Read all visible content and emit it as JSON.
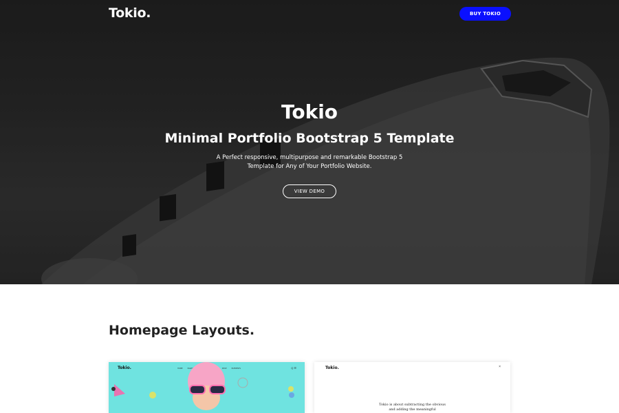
{
  "header": {
    "brand": "Tokio.",
    "buy_button": "BUY TOKIO"
  },
  "hero": {
    "title": "Tokio",
    "subtitle": "Minimal Portfolio Bootstrap 5 Template",
    "description": "A Perfect responsive, multipurpose and remarkable Bootstrap 5 Template for Any of Your Portfolio Website.",
    "demo_button": "VIEW DEMO"
  },
  "section": {
    "title": "Homepage Layouts."
  },
  "cards": [
    {
      "brand": "Tokio.",
      "nav": [
        "HOME",
        "PAGES",
        "PORTFOLIO",
        "BLOG",
        "SHOP",
        "ELEMENTS"
      ],
      "icons": "Q  ☰",
      "background": "#6fe3e0"
    },
    {
      "brand": "Tokio.",
      "close": "×",
      "copy_line1": "Tokio is about subtracting the obvious",
      "copy_line2": "and adding the meaningful"
    }
  ],
  "colors": {
    "accent": "#0a10ff",
    "hero_bg": "#2e2e2e",
    "text_light": "#ffffff"
  }
}
